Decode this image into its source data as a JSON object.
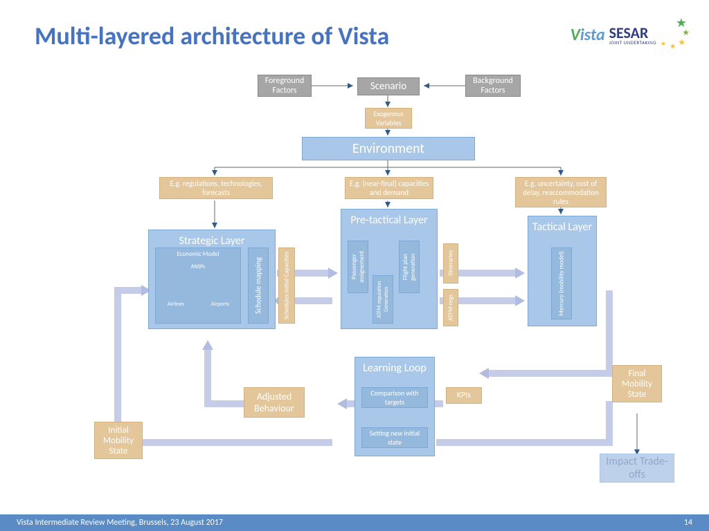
{
  "title": "Multi-layered architecture of Vista",
  "logo": {
    "vista_v": "V",
    "vista_ista": "ista",
    "sesar": "SESAR",
    "sesar_sub": "JOINT UNDERTAKING"
  },
  "boxes": {
    "foreground": "Foreground Factors",
    "scenario": "Scenario",
    "background": "Background Factors",
    "exogenous": "Exogenous Variables",
    "environment": "Environment",
    "eg_reg": "E.g. regulations, technologies, forecasts",
    "eg_cap": "E.g.   (near-final) capacities and demand",
    "eg_unc": "E.g. uncertainty, cost of delay, reaccommodation rules",
    "strategic": "Strategic Layer",
    "pretactical": "Pre-tactical Layer",
    "tactical": "Tactical Layer",
    "econ_model": "Economic Model",
    "ansps": "ANSPs",
    "airlines": "Airlines",
    "airports": "Airports",
    "schedule_mapping": "Schedule mapping",
    "schedules_cap": "Schedules Initial Capacities",
    "pax_assign": "Passenger assignement",
    "atfm_gen": "ATFM regulation Generation",
    "flight_plan": "Flight plan generation",
    "itineraries": "Itineraries",
    "atfm_regs": "ATFM regs",
    "mercury": "Mercury (mobility model)",
    "learning": "Learning Loop",
    "comparison": "Comparison with targets",
    "setting_new": "Setting new initial state",
    "adjusted": "Adjusted Behaviour",
    "kpis": "KPIs",
    "initial_mobility": "Initial Mobility State",
    "final_mobility": "Final Mobility State",
    "impact": "Impact Trade-offs"
  },
  "footer": {
    "text": "Vista Intermediate Review Meeting, Brussels, 23 August 2017",
    "page": "14"
  }
}
